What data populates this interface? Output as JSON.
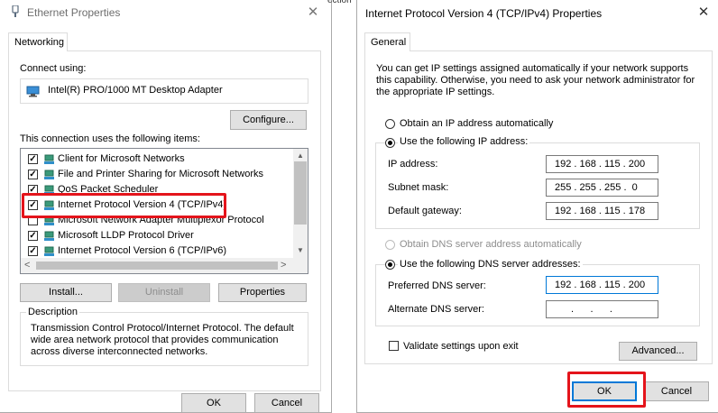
{
  "left": {
    "title": "Ethernet Properties",
    "tab": "Networking",
    "connect_using_label": "Connect using:",
    "adapter": "Intel(R) PRO/1000 MT Desktop Adapter",
    "configure_btn": "Configure...",
    "items_label": "This connection uses the following items:",
    "items": [
      {
        "label": "Client for Microsoft Networks",
        "checked": true
      },
      {
        "label": "File and Printer Sharing for Microsoft Networks",
        "checked": true
      },
      {
        "label": "QoS Packet Scheduler",
        "checked": true
      },
      {
        "label": "Internet Protocol Version 4 (TCP/IPv4)",
        "checked": true
      },
      {
        "label": "Microsoft Network Adapter Multiplexor Protocol",
        "checked": false
      },
      {
        "label": "Microsoft LLDP Protocol Driver",
        "checked": true
      },
      {
        "label": "Internet Protocol Version 6 (TCP/IPv6)",
        "checked": true
      }
    ],
    "install_btn": "Install...",
    "uninstall_btn": "Uninstall",
    "properties_btn": "Properties",
    "description_legend": "Description",
    "description_text": "Transmission Control Protocol/Internet Protocol. The default wide area network protocol that provides communication across diverse interconnected networks.",
    "ok_btn": "OK",
    "cancel_btn": "Cancel"
  },
  "right": {
    "title": "Internet Protocol Version 4 (TCP/IPv4) Properties",
    "tab": "General",
    "intro": "You can get IP settings assigned automatically if your network supports this capability. Otherwise, you need to ask your network administrator for the appropriate IP settings.",
    "obtain_ip_auto": "Obtain an IP address automatically",
    "use_following_ip": "Use the following IP address:",
    "ip_address_label": "IP address:",
    "ip_address": "192 . 168 . 115 . 200",
    "subnet_label": "Subnet mask:",
    "subnet": "255 . 255 . 255 .  0",
    "gateway_label": "Default gateway:",
    "gateway": "192 . 168 . 115 . 178",
    "obtain_dns_auto": "Obtain DNS server address automatically",
    "use_following_dns": "Use the following DNS server addresses:",
    "preferred_dns_label": "Preferred DNS server:",
    "preferred_dns": "192 . 168 . 115 . 200",
    "alternate_dns_label": "Alternate DNS server:",
    "alternate_dns": " .      .      .  ",
    "validate_label": "Validate settings upon exit",
    "advanced_btn": "Advanced...",
    "ok_btn": "OK",
    "cancel_btn": "Cancel"
  },
  "colors": {
    "highlight": "#e4141b",
    "accent": "#0078d7"
  }
}
